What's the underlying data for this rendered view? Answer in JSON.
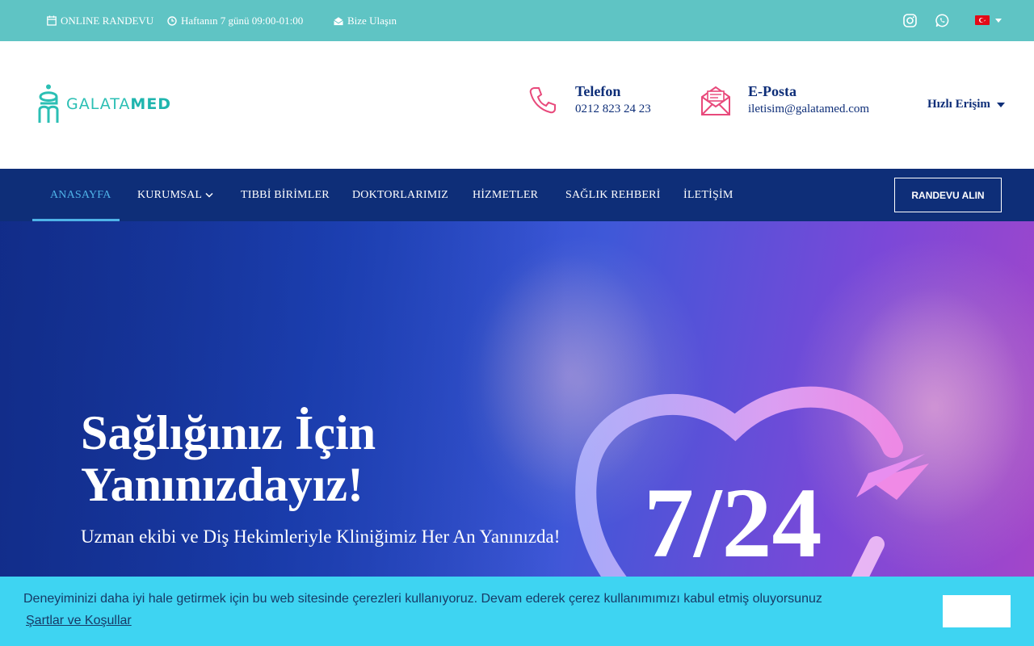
{
  "topbar": {
    "online_randevu": "ONLINE RANDEVU",
    "hours": "Haftanın 7 günü 09:00-01:00",
    "contact": "Bize Ulaşın",
    "icons": [
      "calendar-icon",
      "clock-icon",
      "envelope-open-icon",
      "instagram-icon",
      "whatsapp-icon",
      "turkey-flag-icon"
    ],
    "bg_color": "#5fc4c4"
  },
  "header": {
    "logo_text_left": "GALATA",
    "logo_text_right": "MED",
    "phone_title": "Telefon",
    "phone_value": "0212 823 24 23",
    "email_title": "E-Posta",
    "email_value": "iletisim@galatamed.com",
    "quick_access": "Hızlı Erişim"
  },
  "nav": {
    "items": [
      {
        "label": "ANASAYFA",
        "active": true
      },
      {
        "label": "KURUMSAL",
        "has_dropdown": true
      },
      {
        "label": "TIBBİ BİRİMLER"
      },
      {
        "label": "DOKTORLARIMIZ"
      },
      {
        "label": "HİZMETLER"
      },
      {
        "label": "SAĞLIK REHBERİ"
      },
      {
        "label": "İLETİŞİM"
      }
    ],
    "cta": "RANDEVU ALIN",
    "bg_color": "#0e2e78",
    "active_color": "#4fb3e8"
  },
  "hero": {
    "title": "Sağlığınız İçin Yanınızdayız!",
    "subtitle": "Uzman ekibi ve Diş Hekimleriyle Kliniğimiz Her An Yanınızda!",
    "badge": "7/24"
  },
  "cookie": {
    "message": "Deneyiminizi daha iyi hale getirmek için bu web sitesinde çerezleri kullanıyoruz. Devam ederek çerez kullanımımızı kabul etmiş oluyorsunuz",
    "link": "Şartlar ve Koşullar",
    "bg_color": "#3ed4f2"
  }
}
